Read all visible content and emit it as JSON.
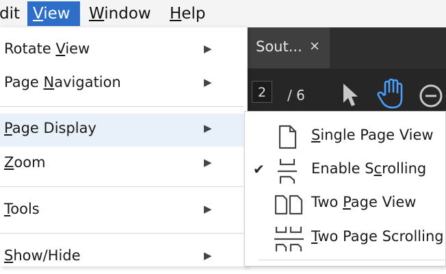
{
  "menubar": {
    "items": [
      {
        "label": "dit",
        "accel": ""
      },
      {
        "label": "View",
        "accel": "V",
        "active": true
      },
      {
        "label": "Window",
        "accel": "W"
      },
      {
        "label": "Help",
        "accel": "H"
      }
    ]
  },
  "document": {
    "tab_title": "Sout...",
    "tab_close": "×",
    "current_page": "2",
    "total_pages": "/ 6"
  },
  "view_menu": {
    "items": [
      {
        "pre": "Rotate ",
        "acc": "V",
        "post": "iew",
        "arrow": "▶"
      },
      {
        "pre": "Page ",
        "acc": "N",
        "post": "avigation",
        "arrow": "▶"
      },
      {
        "pre": "",
        "acc": "P",
        "post": "age Display",
        "arrow": "▶",
        "highlighted": true
      },
      {
        "pre": "",
        "acc": "Z",
        "post": "oom",
        "arrow": "▶"
      },
      {
        "pre": "",
        "acc": "T",
        "post": "ools",
        "arrow": "▶"
      },
      {
        "pre": "",
        "acc": "S",
        "post": "how/Hide",
        "arrow": "▶"
      }
    ]
  },
  "page_display_menu": {
    "items": [
      {
        "pre": "",
        "acc": "S",
        "post": "ingle Page View",
        "icon": "single-page-icon",
        "checked": false
      },
      {
        "pre": "Enable S",
        "acc": "c",
        "post": "rolling",
        "icon": "scrolling-icon",
        "checked": true
      },
      {
        "pre": "Two ",
        "acc": "P",
        "post": "age View",
        "icon": "two-page-icon",
        "checked": false
      },
      {
        "pre": "",
        "acc": "T",
        "post": "wo Page Scrolling",
        "icon": "two-page-scrolling-icon",
        "checked": false
      }
    ],
    "check_glyph": "✔"
  },
  "colors": {
    "menu_active": "#2c6ec8",
    "highlight": "#e8f0fa",
    "hand_tool": "#4a9eff",
    "dark_bg": "#2e2e2e"
  }
}
